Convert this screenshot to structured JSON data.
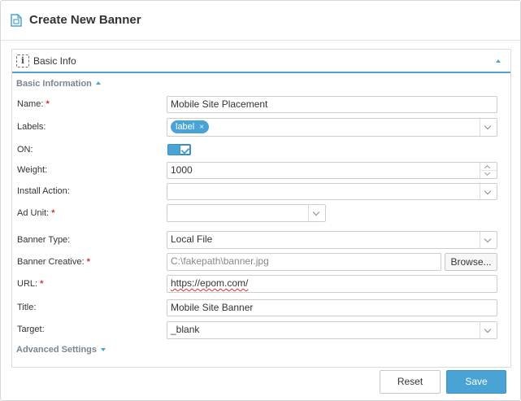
{
  "window": {
    "title": "Create New Banner"
  },
  "panel": {
    "title": "Basic Info"
  },
  "sections": {
    "basic": "Basic Information",
    "advanced": "Advanced Settings"
  },
  "form": {
    "name": {
      "label": "Name:",
      "required": "*",
      "value": "Mobile Site Placement"
    },
    "labels": {
      "label": "Labels:",
      "tag": "label",
      "tag_remove": "×"
    },
    "on": {
      "label": "ON:",
      "checked": true
    },
    "weight": {
      "label": "Weight:",
      "value": "1000"
    },
    "install_action": {
      "label": "Install Action:",
      "value": ""
    },
    "ad_unit": {
      "label": "Ad Unit:",
      "required": "*",
      "value": ""
    },
    "banner_type": {
      "label": "Banner Type:",
      "value": "Local File"
    },
    "banner_creative": {
      "label": "Banner Creative:",
      "required": "*",
      "value": "C:\\fakepath\\banner.jpg",
      "browse": "Browse..."
    },
    "url": {
      "label": "URL:",
      "required": "*",
      "value": "https://epom.com/"
    },
    "title": {
      "label": "Title:",
      "value": "Mobile Site Banner"
    },
    "target": {
      "label": "Target:",
      "value": "_blank"
    }
  },
  "buttons": {
    "reset": "Reset",
    "save": "Save"
  },
  "colors": {
    "accent": "#4aa3d5",
    "required": "#d9302f",
    "section": "#7b8591"
  }
}
